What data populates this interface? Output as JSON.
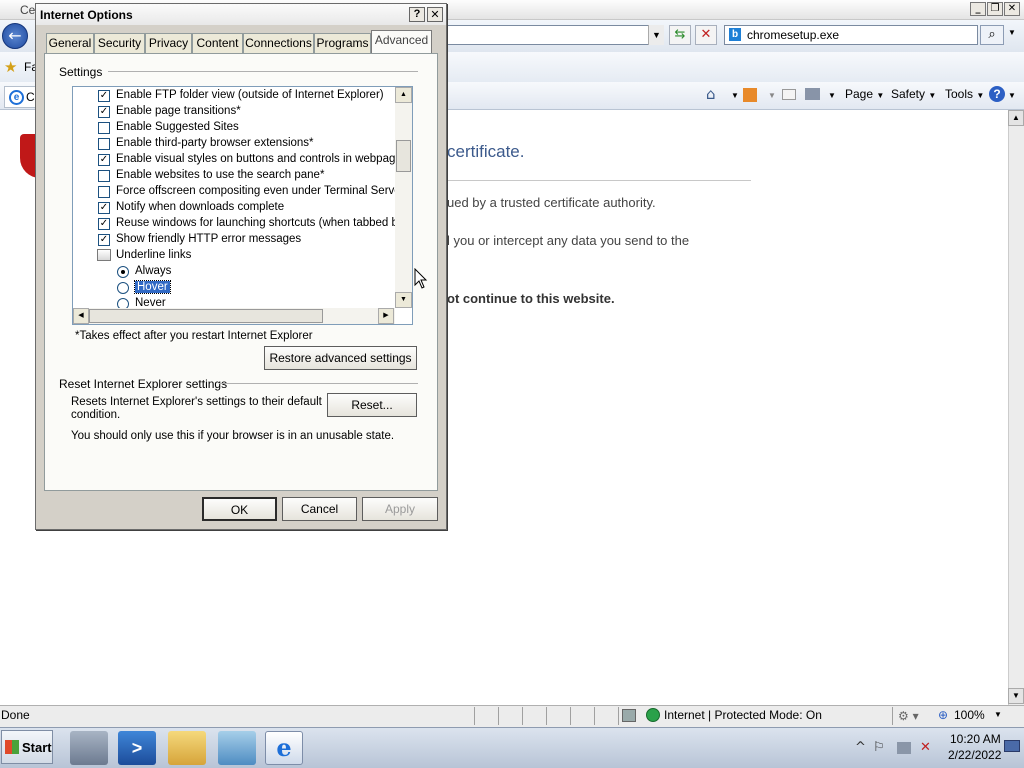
{
  "browser": {
    "title_partial": "Ce",
    "address_value": "",
    "search_value": "chromesetup.exe",
    "favorites_label": "Fa",
    "tab_label": "Ce",
    "command_bar": {
      "page": "Page",
      "safety": "Safety",
      "tools": "Tools"
    }
  },
  "page_content": {
    "heading": "certificate.",
    "line1": "ued by a trusted certificate authority.",
    "line2": "l you or intercept any data you send to the",
    "line3": "ot continue to this website."
  },
  "statusbar": {
    "status": "Done",
    "zone": "Internet | Protected Mode: On",
    "zoom": "100%"
  },
  "taskbar": {
    "start_label": "Start",
    "time": "10:20 AM",
    "date": "2/22/2022"
  },
  "dialog": {
    "title": "Internet Options",
    "help_glyph": "?",
    "close_glyph": "✕",
    "tabs": [
      "General",
      "Security",
      "Privacy",
      "Content",
      "Connections",
      "Programs",
      "Advanced"
    ],
    "active_tab": "Advanced",
    "settings_label": "Settings",
    "settings_items": [
      {
        "kind": "checkbox",
        "checked": true,
        "label": "Enable FTP folder view (outside of Internet Explorer)"
      },
      {
        "kind": "checkbox",
        "checked": true,
        "label": "Enable page transitions*"
      },
      {
        "kind": "checkbox",
        "checked": false,
        "label": "Enable Suggested Sites"
      },
      {
        "kind": "checkbox",
        "checked": false,
        "label": "Enable third-party browser extensions*"
      },
      {
        "kind": "checkbox",
        "checked": true,
        "label": "Enable visual styles on buttons and controls in webpages"
      },
      {
        "kind": "checkbox",
        "checked": false,
        "label": "Enable websites to use the search pane*"
      },
      {
        "kind": "checkbox",
        "checked": false,
        "label": "Force offscreen compositing even under Terminal Server*"
      },
      {
        "kind": "checkbox",
        "checked": true,
        "label": "Notify when downloads complete"
      },
      {
        "kind": "checkbox",
        "checked": true,
        "label": "Reuse windows for launching shortcuts (when tabbed bro"
      },
      {
        "kind": "checkbox",
        "checked": true,
        "label": "Show friendly HTTP error messages"
      },
      {
        "kind": "group",
        "label": "Underline links"
      },
      {
        "kind": "radio",
        "checked": true,
        "label": "Always"
      },
      {
        "kind": "radio",
        "checked": false,
        "selected": true,
        "label": "Hover"
      },
      {
        "kind": "radio",
        "checked": false,
        "label": "Never"
      }
    ],
    "restart_note": "*Takes effect after you restart Internet Explorer",
    "restore_button": "Restore advanced settings",
    "reset_section_label": "Reset Internet Explorer settings",
    "reset_desc_line1": "Resets Internet Explorer's settings to their default",
    "reset_desc_line2": "condition.",
    "reset_button": "Reset...",
    "reset_warning": "You should only use this if your browser is in an unusable state.",
    "ok_button": "OK",
    "cancel_button": "Cancel",
    "apply_button": "Apply"
  }
}
